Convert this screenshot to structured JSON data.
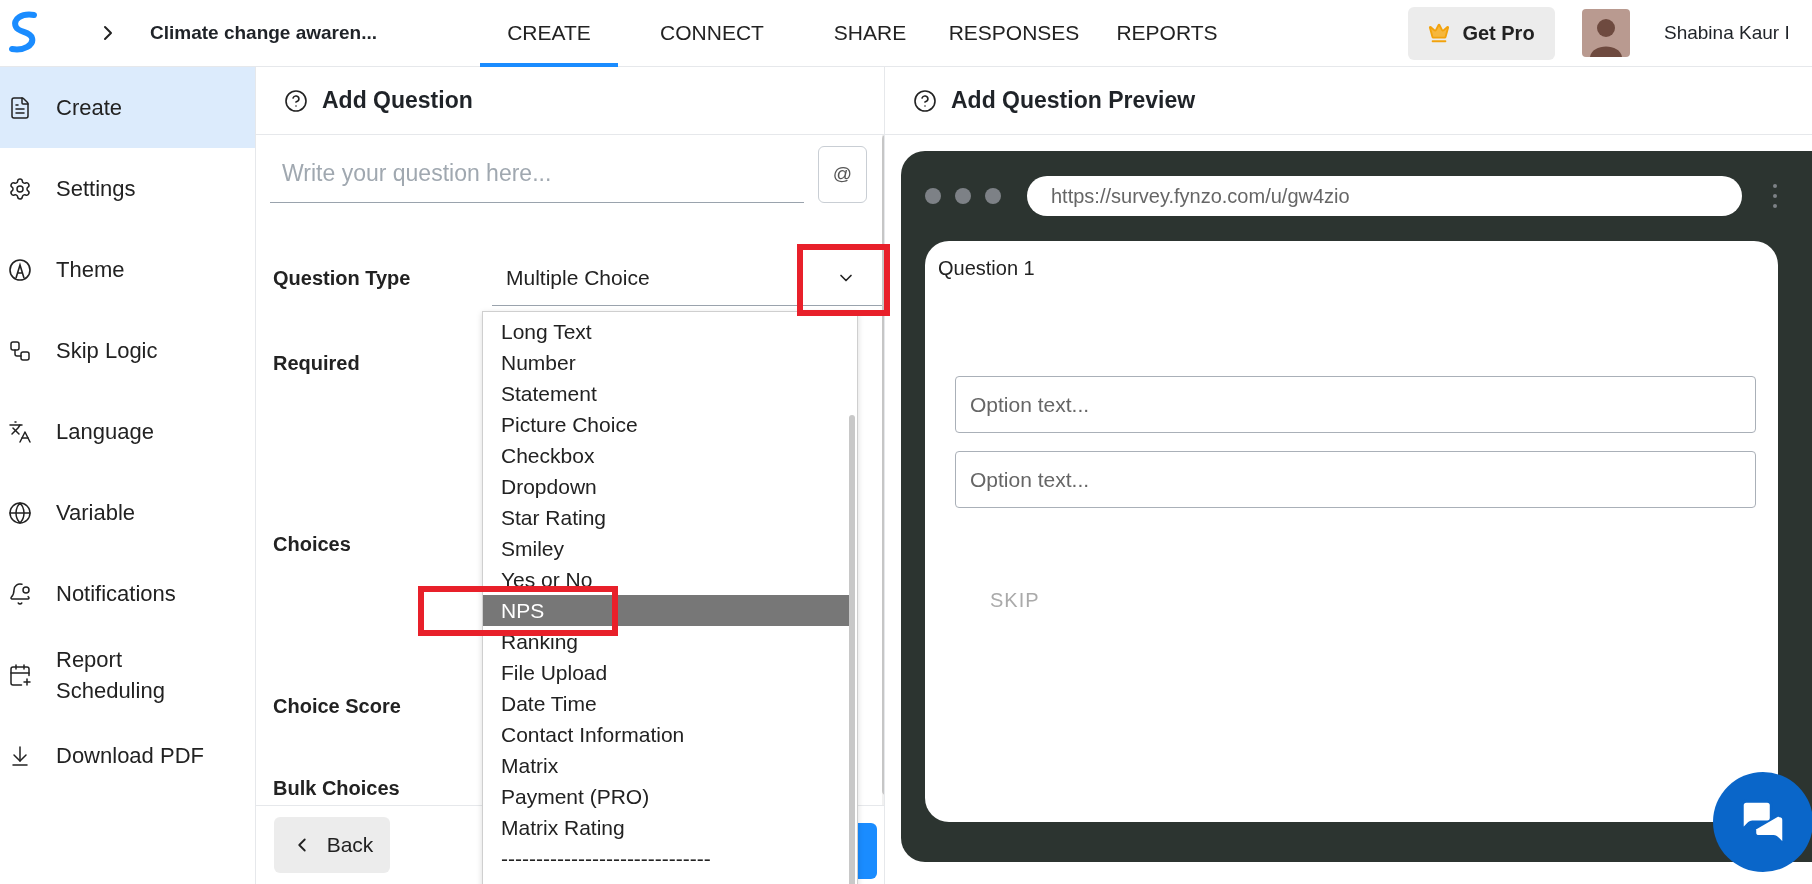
{
  "app": {
    "title": "Climate change awaren..."
  },
  "tabs": [
    {
      "label": "CREATE",
      "selected": true
    },
    {
      "label": "CONNECT",
      "selected": false
    },
    {
      "label": "SHARE",
      "selected": false
    },
    {
      "label": "RESPONSES",
      "selected": false
    },
    {
      "label": "REPORTS",
      "selected": false
    }
  ],
  "get_pro": "Get Pro",
  "user": {
    "name": "Shabina Kaur I"
  },
  "sidebar": {
    "items": [
      {
        "label": "Create",
        "selected": true
      },
      {
        "label": "Settings",
        "selected": false
      },
      {
        "label": "Theme",
        "selected": false
      },
      {
        "label": "Skip Logic",
        "selected": false
      },
      {
        "label": "Language",
        "selected": false
      },
      {
        "label": "Variable",
        "selected": false
      },
      {
        "label": "Notifications",
        "selected": false
      },
      {
        "label": "Report Scheduling",
        "selected": false
      },
      {
        "label": "Download PDF",
        "selected": false
      }
    ]
  },
  "editor": {
    "title": "Add Question",
    "question": {
      "placeholder": "Write your question here..."
    },
    "mention_button": "@",
    "question_type": {
      "label": "Question Type",
      "value": "Multiple Choice",
      "expanded": true
    },
    "fields": [
      "Required",
      "Choices",
      "Choice Score",
      "Bulk Choices"
    ],
    "dropdown": {
      "options": [
        {
          "label": "Long Text",
          "selected": false
        },
        {
          "label": "Number",
          "selected": false
        },
        {
          "label": "Statement",
          "selected": false
        },
        {
          "label": "Picture Choice",
          "selected": false
        },
        {
          "label": "Checkbox",
          "selected": false
        },
        {
          "label": "Dropdown",
          "selected": false
        },
        {
          "label": "Star Rating",
          "selected": false
        },
        {
          "label": "Smiley",
          "selected": false
        },
        {
          "label": "Yes or No",
          "selected": false
        },
        {
          "label": "NPS",
          "selected": true
        },
        {
          "label": "Ranking",
          "selected": false
        },
        {
          "label": "File Upload",
          "selected": false
        },
        {
          "label": "Date Time",
          "selected": false
        },
        {
          "label": "Contact Information",
          "selected": false
        },
        {
          "label": "Matrix",
          "selected": false
        },
        {
          "label": "Payment (PRO)",
          "selected": false
        },
        {
          "label": "Matrix Rating",
          "selected": false
        },
        {
          "label": "------------------------------",
          "selected": false
        }
      ]
    },
    "back_button": "Back"
  },
  "preview": {
    "title": "Add Question Preview",
    "url": "https://survey.fynzo.com/u/gw4zio",
    "question_label": "Question 1",
    "options": [
      {
        "placeholder": "Option text..."
      },
      {
        "placeholder": "Option text..."
      }
    ],
    "skip": "SKIP"
  }
}
